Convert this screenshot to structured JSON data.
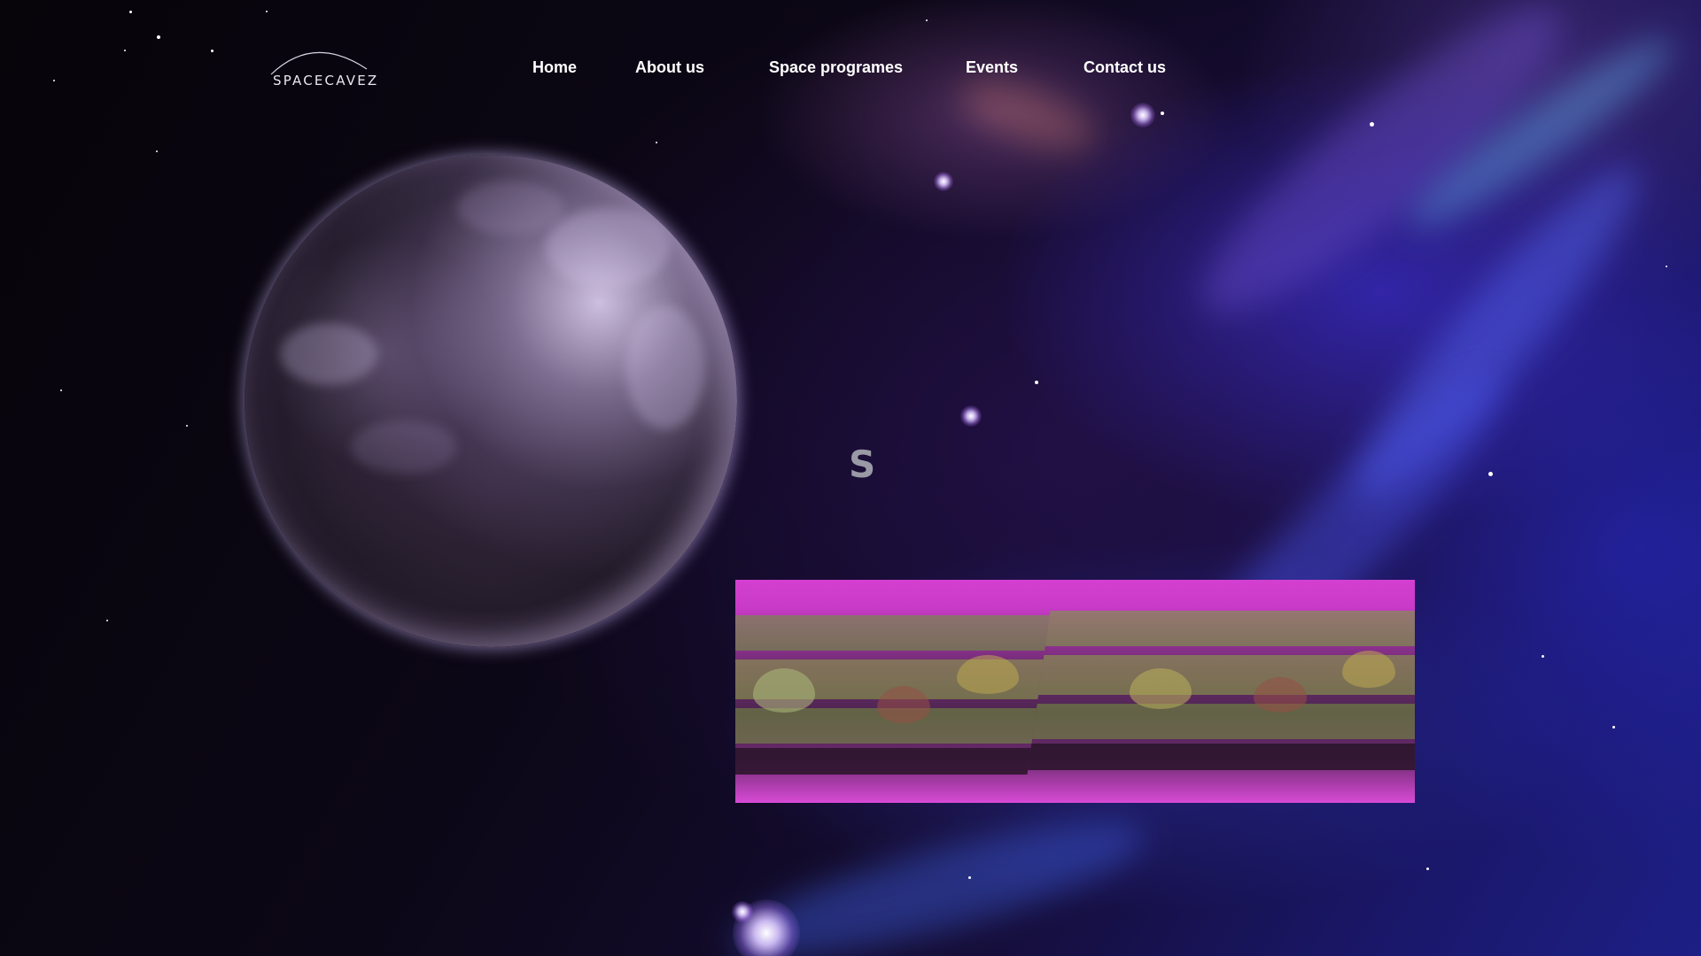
{
  "brand": {
    "logo_text": "SPACECAVEZ"
  },
  "nav": {
    "items": [
      {
        "label": "Home"
      },
      {
        "label": "About us"
      },
      {
        "label": "Space programes"
      },
      {
        "label": "Events"
      },
      {
        "label": "Contact us"
      }
    ]
  },
  "hero": {
    "heading": "S"
  },
  "theme": {
    "nav_text_color": "#ffffff",
    "heading_color": "#9a99a6",
    "grow_light_color": "#d43fd0",
    "nebula_color": "#2a2fb0"
  }
}
